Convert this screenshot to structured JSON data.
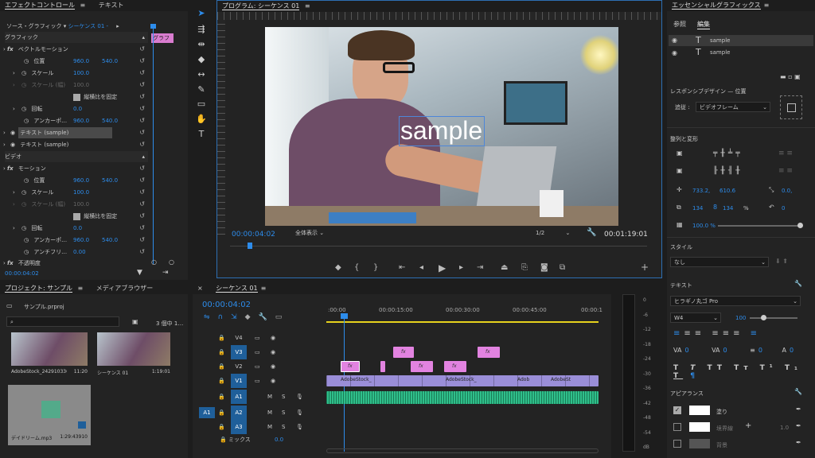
{
  "effect_controls": {
    "tab1": "エフェクトコントロール",
    "menu_icon": "≡",
    "tab2": "テキスト",
    "source_label": "ソース・グラフィック",
    "seq_label": "シーケンス 01 -",
    "clip_label": "グラフ",
    "section_graphic": "グラフィック",
    "vector_motion": "ベクトルモーション",
    "position": "位置",
    "pos_x": "960.0",
    "pos_y": "540.0",
    "scale": "スケール",
    "scale_val": "100.0",
    "scale_w": "スケール (幅)",
    "scale_w_val": "100.0",
    "uniform": "縦横比を固定",
    "rotation": "回転",
    "rot_val": "0.0",
    "anchor": "アンカーポ…",
    "anc_x": "960.0",
    "anc_y": "540.0",
    "text1": "テキスト (sample)",
    "text2": "テキスト (sample)",
    "section_video": "ビデオ",
    "motion": "モーション",
    "position2": "位置",
    "pos2_x": "960.0",
    "pos2_y": "540.0",
    "scale2": "スケール",
    "scale2_val": "100.0",
    "scale2_w": "スケール (幅)",
    "scale2_w_val": "100.0",
    "uniform2": "縦横比を固定",
    "rotation2": "回転",
    "rot2_val": "0.0",
    "anchor2": "アンカーポ…",
    "anc2_x": "960.0",
    "anc2_y": "540.0",
    "antiflicker": "アンチフリ…",
    "af_val": "0.00",
    "opacity": "不透明度",
    "timecode": "00:00:04:02"
  },
  "program": {
    "title": "プログラム: シーケンス 01",
    "menu_icon": "≡",
    "overlay_text": "sample",
    "timecode": "00:00:04:02",
    "fit": "全体表示",
    "quality": "1/2",
    "duration": "00:01:19:01"
  },
  "project": {
    "tab1": "プロジェクト: サンプル",
    "menu_icon": "≡",
    "tab2": "メディアブラウザー",
    "file": "サンプル.prproj",
    "count": "3 個中 1…",
    "items": [
      {
        "name": "AdobeStock_242910336…",
        "dur": "11:20"
      },
      {
        "name": "シーケンス 01",
        "dur": "1:19:01"
      },
      {
        "name": "デイドリーム.mp3",
        "dur": "1:29:43910"
      }
    ]
  },
  "timeline": {
    "tab": "シーケンス 01",
    "menu_icon": "≡",
    "timecode": "00:00:04:02",
    "ruler": [
      ":00:00",
      "00:00:15:00",
      "00:00:30:00",
      "00:00:45:00",
      "00:00:1"
    ],
    "tracks": [
      "V4",
      "V3",
      "V2",
      "V1",
      "A1",
      "A2",
      "A3"
    ],
    "source_a1": "A1",
    "mix": "ミックス",
    "mix_val": "0.0",
    "clips": {
      "v1a": "AdobeStock_",
      "v1b": "AdobeStock_",
      "v1c": "Adob",
      "v1d": "AdobeSt"
    },
    "fx": "fx"
  },
  "meter": {
    "scale": [
      "0",
      "-6",
      "-12",
      "-18",
      "-24",
      "-30",
      "-36",
      "-42",
      "-48",
      "-54",
      "dB"
    ]
  },
  "essential": {
    "title": "エッセンシャルグラフィックス",
    "menu_icon": "≡",
    "tab_browse": "参照",
    "tab_edit": "編集",
    "layer1": "sample",
    "layer2": "sample",
    "responsive": "レスポンシブデザイン — 位置",
    "follow": "追従 :",
    "follow_val": "ビデオフレーム",
    "align": "整列と変形",
    "pos_x": "733.2,",
    "pos_y": "610.6",
    "rot": "0.0,",
    "scale": "134",
    "scale2": "134",
    "pct": "%",
    "rot2": "0",
    "opacity": "100.0 %",
    "style": "スタイル",
    "style_val": "なし",
    "text": "テキスト",
    "font": "ヒラギノ丸ゴ Pro",
    "weight": "W4",
    "size": "100",
    "va1": "0",
    "va2": "0",
    "va3": "0",
    "va4": "0",
    "appearance": "アピアランス",
    "fill": "塗り",
    "stroke": "境界線",
    "stroke_w": "1.0",
    "bg": "背景",
    "colors": {
      "fill": "#ffffff",
      "stroke": "#ffffff"
    }
  },
  "colors": {
    "accent": "#2d8ceb",
    "clip_pink": "#e283e0",
    "clip_purple": "#9a8ed8",
    "audio_green": "#2fbf8b",
    "track_blue": "#1f5f9a"
  }
}
